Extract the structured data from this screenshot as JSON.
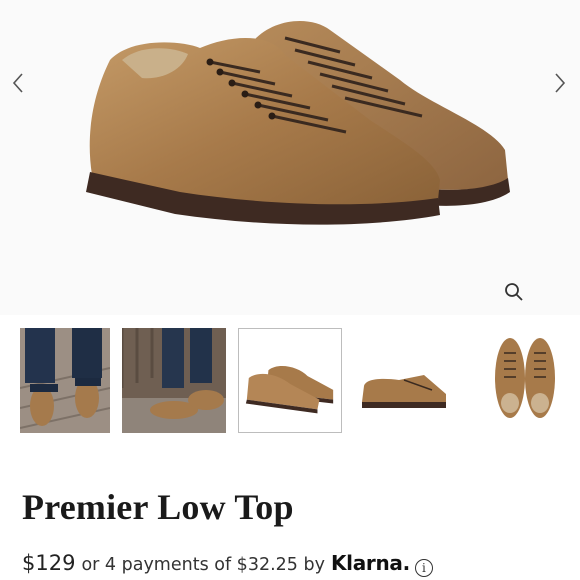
{
  "product": {
    "title": "Premier Low Top",
    "price": "$129",
    "installments_text": "or 4 payments of $32.25 by",
    "payment_provider": "Klarna.",
    "info_symbol": "i"
  },
  "gallery": {
    "prev_icon": "chevron-left-icon",
    "next_icon": "chevron-right-icon",
    "zoom_icon": "magnifier-icon",
    "selected_thumbnail": 3,
    "thumbnail_count": 5
  },
  "colors": {
    "leather": "#a77a4a",
    "sole": "#3e2a22",
    "laces": "#3a2a20",
    "thumb_border": "#bdbdbd"
  }
}
